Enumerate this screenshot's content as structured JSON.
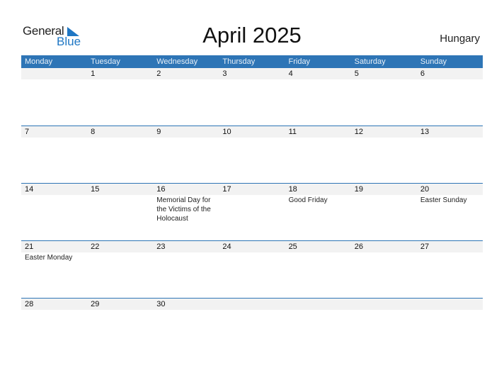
{
  "logo": {
    "line1": "General",
    "line2": "Blue"
  },
  "title": "April 2025",
  "country": "Hungary",
  "colors": {
    "header": "#2e75b6",
    "datebar": "#f2f2f2",
    "logo_blue": "#1f77c4"
  },
  "weekdays": [
    "Monday",
    "Tuesday",
    "Wednesday",
    "Thursday",
    "Friday",
    "Saturday",
    "Sunday"
  ],
  "weeks": [
    [
      {
        "day": "",
        "event": ""
      },
      {
        "day": "1",
        "event": ""
      },
      {
        "day": "2",
        "event": ""
      },
      {
        "day": "3",
        "event": ""
      },
      {
        "day": "4",
        "event": ""
      },
      {
        "day": "5",
        "event": ""
      },
      {
        "day": "6",
        "event": ""
      }
    ],
    [
      {
        "day": "7",
        "event": ""
      },
      {
        "day": "8",
        "event": ""
      },
      {
        "day": "9",
        "event": ""
      },
      {
        "day": "10",
        "event": ""
      },
      {
        "day": "11",
        "event": ""
      },
      {
        "day": "12",
        "event": ""
      },
      {
        "day": "13",
        "event": ""
      }
    ],
    [
      {
        "day": "14",
        "event": ""
      },
      {
        "day": "15",
        "event": ""
      },
      {
        "day": "16",
        "event": "Memorial Day for the Victims of the Holocaust"
      },
      {
        "day": "17",
        "event": ""
      },
      {
        "day": "18",
        "event": "Good Friday"
      },
      {
        "day": "19",
        "event": ""
      },
      {
        "day": "20",
        "event": "Easter Sunday"
      }
    ],
    [
      {
        "day": "21",
        "event": "Easter Monday"
      },
      {
        "day": "22",
        "event": ""
      },
      {
        "day": "23",
        "event": ""
      },
      {
        "day": "24",
        "event": ""
      },
      {
        "day": "25",
        "event": ""
      },
      {
        "day": "26",
        "event": ""
      },
      {
        "day": "27",
        "event": ""
      }
    ],
    [
      {
        "day": "28",
        "event": ""
      },
      {
        "day": "29",
        "event": ""
      },
      {
        "day": "30",
        "event": ""
      },
      {
        "day": "",
        "event": ""
      },
      {
        "day": "",
        "event": ""
      },
      {
        "day": "",
        "event": ""
      },
      {
        "day": "",
        "event": ""
      }
    ]
  ]
}
